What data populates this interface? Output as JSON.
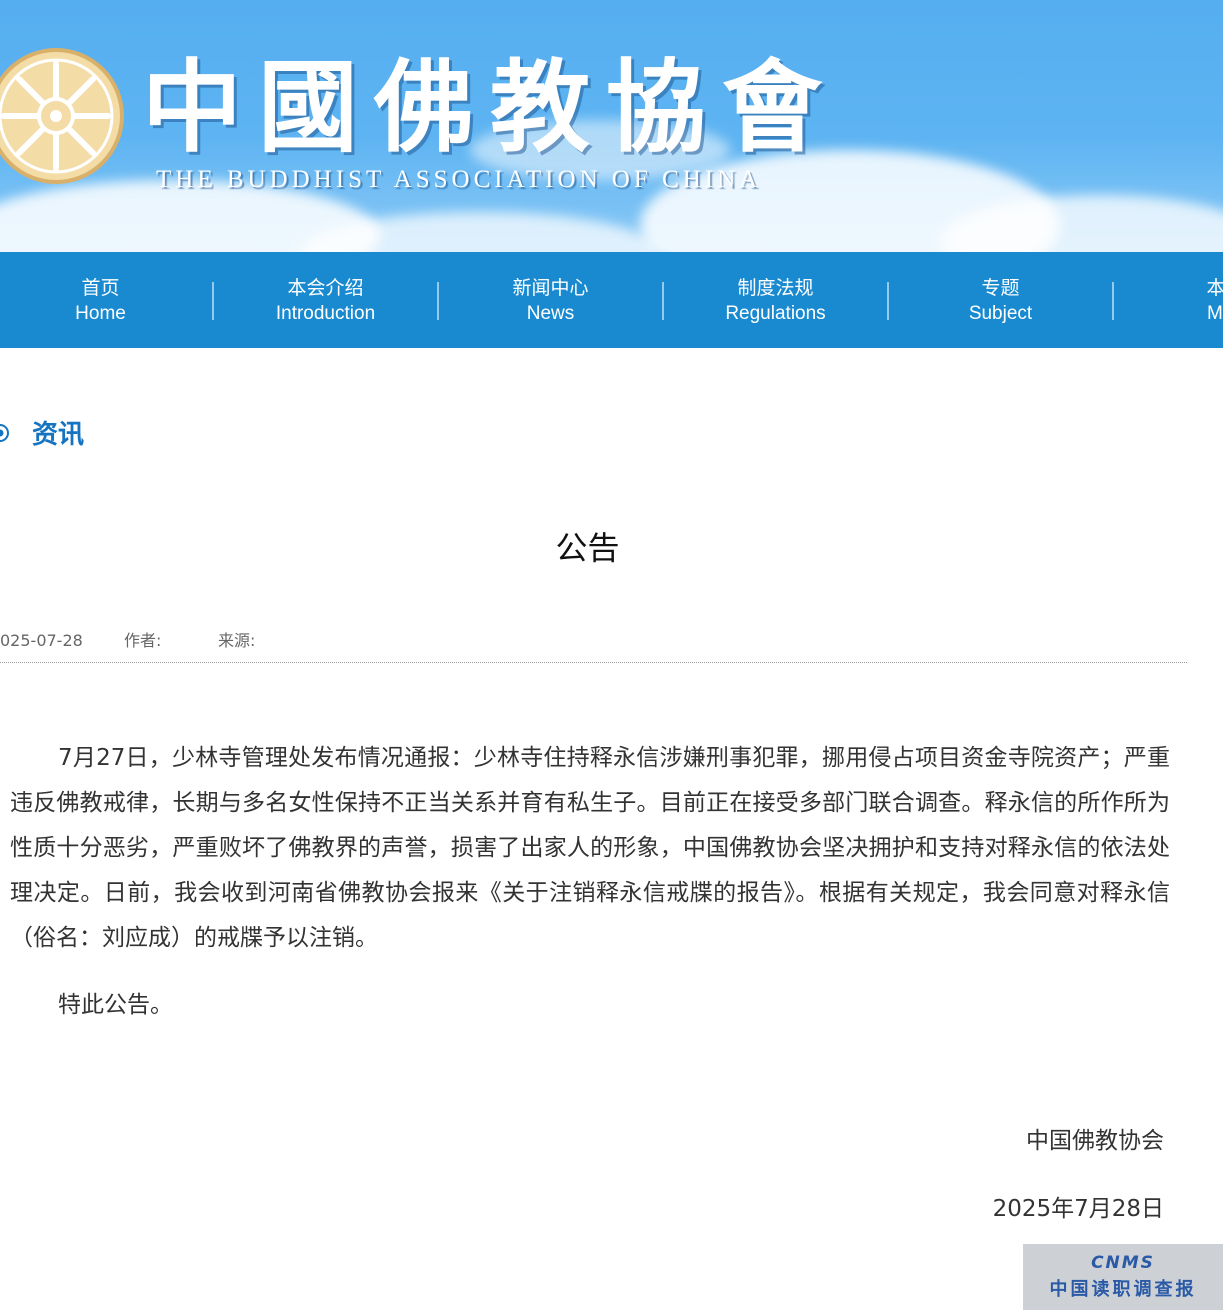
{
  "colors": {
    "banner_sky": "#55aef0",
    "nav_background": "#1a8ad0",
    "accent": "#1573c0",
    "body_text": "#333333"
  },
  "header": {
    "logo_cn": "中國佛教協會",
    "logo_en": "THE BUDDHIST ASSOCIATION OF CHINA",
    "emblem_icon": "dharma-wheel-icon"
  },
  "nav": {
    "items": [
      {
        "cn": "首页",
        "en": "Home"
      },
      {
        "cn": "本会介绍",
        "en": "Introduction"
      },
      {
        "cn": "新闻中心",
        "en": "News"
      },
      {
        "cn": "制度法规",
        "en": "Regulations"
      },
      {
        "cn": "专题",
        "en": "Subject"
      },
      {
        "cn": "本会",
        "en": "Mag"
      }
    ]
  },
  "section": {
    "title": "资讯",
    "icon": "target-icon"
  },
  "article": {
    "title": "公告",
    "date": "025-07-28",
    "author_label": "作者:",
    "source_label": "来源:",
    "paragraph_1": "7月27日，少林寺管理处发布情况通报：少林寺住持释永信涉嫌刑事犯罪，挪用侵占项目资金寺院资产；严重违反佛教戒律，长期与多名女性保持不正当关系并育有私生子。目前正在接受多部门联合调查。释永信的所作所为性质十分恶劣，严重败坏了佛教界的声誉，损害了出家人的形象，中国佛教协会坚决拥护和支持对释永信的依法处理决定。日前，我会收到河南省佛教协会报来《关于注销释永信戒牒的报告》。根据有关规定，我会同意对释永信（俗名：刘应成）的戒牒予以注销。",
    "paragraph_2": "特此公告。",
    "signature": "中国佛教协会",
    "sign_date": "2025年7月28日"
  },
  "watermark": {
    "logo": "CNMS",
    "text": "中国读职调查报"
  }
}
